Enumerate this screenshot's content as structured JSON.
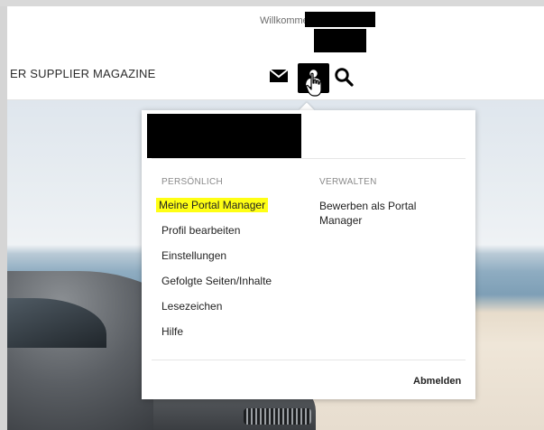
{
  "header": {
    "welcome": "Willkommen",
    "brand": "ER SUPPLIER MAGAZINE",
    "icons": {
      "mail": "envelope-icon",
      "user": "user-icon",
      "search": "search-icon",
      "cursor": "hand-pointer-icon"
    }
  },
  "dropdown": {
    "personal": {
      "heading": "PERSÖNLICH",
      "items": [
        "Meine Portal Manager",
        "Profil bearbeiten",
        "Einstellungen",
        "Gefolgte Seiten/Inhalte",
        "Lesezeichen",
        "Hilfe"
      ]
    },
    "manage": {
      "heading": "VERWALTEN",
      "items": [
        "Bewerben als Portal Manager"
      ]
    },
    "logout": "Abmelden"
  },
  "colors": {
    "highlight": "#ffff14",
    "icon_dark": "#000000"
  }
}
